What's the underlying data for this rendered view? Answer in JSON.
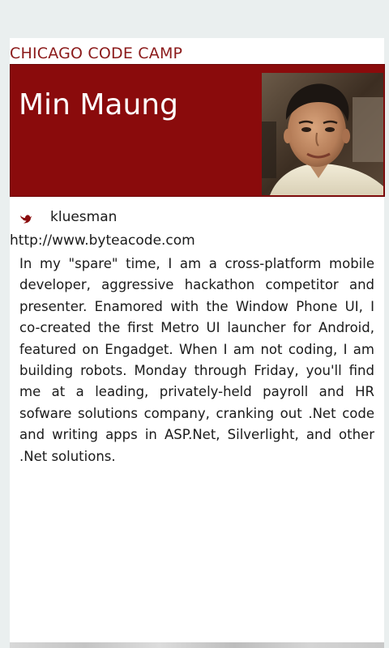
{
  "app": {
    "title": "CHICAGO CODE CAMP"
  },
  "speaker": {
    "name": "Min Maung",
    "photo_alt": "Speaker photo",
    "twitter_icon": "twitter-bird-icon",
    "twitter_handle": "kluesman",
    "website": "http://www.byteacode.com",
    "bio": "In my \"spare\" time, I am a cross-platform mobile developer, aggressive hackathon competitor and presenter. Enamored with the Window Phone UI, I co-created the first Metro UI launcher for Android, featured on Engadget. When I am not coding, I am building robots. Monday through Friday, you'll find me at a leading, privately-held payroll and HR sofware solutions company, cranking out .Net code and writing apps in ASP.Net, Silverlight, and other .Net solutions."
  },
  "colors": {
    "accent": "#8a0b0c",
    "title": "#8b1a1a",
    "background": "#eaefef",
    "card": "#ffffff"
  }
}
